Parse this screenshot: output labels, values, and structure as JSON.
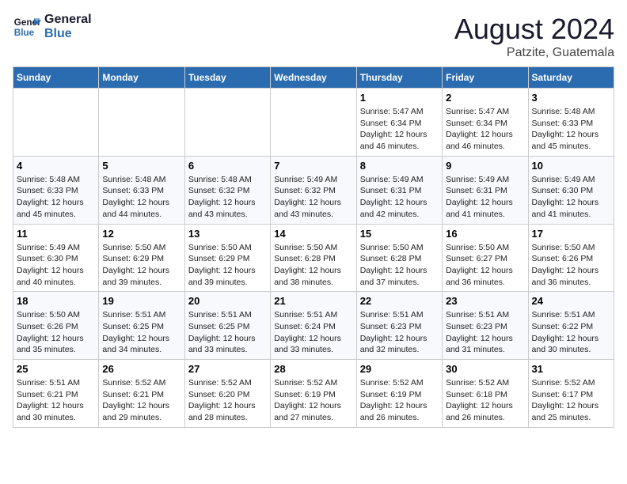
{
  "header": {
    "logo_line1": "General",
    "logo_line2": "Blue",
    "month": "August 2024",
    "location": "Patzite, Guatemala"
  },
  "weekdays": [
    "Sunday",
    "Monday",
    "Tuesday",
    "Wednesday",
    "Thursday",
    "Friday",
    "Saturday"
  ],
  "weeks": [
    [
      {
        "day": "",
        "info": ""
      },
      {
        "day": "",
        "info": ""
      },
      {
        "day": "",
        "info": ""
      },
      {
        "day": "",
        "info": ""
      },
      {
        "day": "1",
        "info": "Sunrise: 5:47 AM\nSunset: 6:34 PM\nDaylight: 12 hours\nand 46 minutes."
      },
      {
        "day": "2",
        "info": "Sunrise: 5:47 AM\nSunset: 6:34 PM\nDaylight: 12 hours\nand 46 minutes."
      },
      {
        "day": "3",
        "info": "Sunrise: 5:48 AM\nSunset: 6:33 PM\nDaylight: 12 hours\nand 45 minutes."
      }
    ],
    [
      {
        "day": "4",
        "info": "Sunrise: 5:48 AM\nSunset: 6:33 PM\nDaylight: 12 hours\nand 45 minutes."
      },
      {
        "day": "5",
        "info": "Sunrise: 5:48 AM\nSunset: 6:33 PM\nDaylight: 12 hours\nand 44 minutes."
      },
      {
        "day": "6",
        "info": "Sunrise: 5:48 AM\nSunset: 6:32 PM\nDaylight: 12 hours\nand 43 minutes."
      },
      {
        "day": "7",
        "info": "Sunrise: 5:49 AM\nSunset: 6:32 PM\nDaylight: 12 hours\nand 43 minutes."
      },
      {
        "day": "8",
        "info": "Sunrise: 5:49 AM\nSunset: 6:31 PM\nDaylight: 12 hours\nand 42 minutes."
      },
      {
        "day": "9",
        "info": "Sunrise: 5:49 AM\nSunset: 6:31 PM\nDaylight: 12 hours\nand 41 minutes."
      },
      {
        "day": "10",
        "info": "Sunrise: 5:49 AM\nSunset: 6:30 PM\nDaylight: 12 hours\nand 41 minutes."
      }
    ],
    [
      {
        "day": "11",
        "info": "Sunrise: 5:49 AM\nSunset: 6:30 PM\nDaylight: 12 hours\nand 40 minutes."
      },
      {
        "day": "12",
        "info": "Sunrise: 5:50 AM\nSunset: 6:29 PM\nDaylight: 12 hours\nand 39 minutes."
      },
      {
        "day": "13",
        "info": "Sunrise: 5:50 AM\nSunset: 6:29 PM\nDaylight: 12 hours\nand 39 minutes."
      },
      {
        "day": "14",
        "info": "Sunrise: 5:50 AM\nSunset: 6:28 PM\nDaylight: 12 hours\nand 38 minutes."
      },
      {
        "day": "15",
        "info": "Sunrise: 5:50 AM\nSunset: 6:28 PM\nDaylight: 12 hours\nand 37 minutes."
      },
      {
        "day": "16",
        "info": "Sunrise: 5:50 AM\nSunset: 6:27 PM\nDaylight: 12 hours\nand 36 minutes."
      },
      {
        "day": "17",
        "info": "Sunrise: 5:50 AM\nSunset: 6:26 PM\nDaylight: 12 hours\nand 36 minutes."
      }
    ],
    [
      {
        "day": "18",
        "info": "Sunrise: 5:50 AM\nSunset: 6:26 PM\nDaylight: 12 hours\nand 35 minutes."
      },
      {
        "day": "19",
        "info": "Sunrise: 5:51 AM\nSunset: 6:25 PM\nDaylight: 12 hours\nand 34 minutes."
      },
      {
        "day": "20",
        "info": "Sunrise: 5:51 AM\nSunset: 6:25 PM\nDaylight: 12 hours\nand 33 minutes."
      },
      {
        "day": "21",
        "info": "Sunrise: 5:51 AM\nSunset: 6:24 PM\nDaylight: 12 hours\nand 33 minutes."
      },
      {
        "day": "22",
        "info": "Sunrise: 5:51 AM\nSunset: 6:23 PM\nDaylight: 12 hours\nand 32 minutes."
      },
      {
        "day": "23",
        "info": "Sunrise: 5:51 AM\nSunset: 6:23 PM\nDaylight: 12 hours\nand 31 minutes."
      },
      {
        "day": "24",
        "info": "Sunrise: 5:51 AM\nSunset: 6:22 PM\nDaylight: 12 hours\nand 30 minutes."
      }
    ],
    [
      {
        "day": "25",
        "info": "Sunrise: 5:51 AM\nSunset: 6:21 PM\nDaylight: 12 hours\nand 30 minutes."
      },
      {
        "day": "26",
        "info": "Sunrise: 5:52 AM\nSunset: 6:21 PM\nDaylight: 12 hours\nand 29 minutes."
      },
      {
        "day": "27",
        "info": "Sunrise: 5:52 AM\nSunset: 6:20 PM\nDaylight: 12 hours\nand 28 minutes."
      },
      {
        "day": "28",
        "info": "Sunrise: 5:52 AM\nSunset: 6:19 PM\nDaylight: 12 hours\nand 27 minutes."
      },
      {
        "day": "29",
        "info": "Sunrise: 5:52 AM\nSunset: 6:19 PM\nDaylight: 12 hours\nand 26 minutes."
      },
      {
        "day": "30",
        "info": "Sunrise: 5:52 AM\nSunset: 6:18 PM\nDaylight: 12 hours\nand 26 minutes."
      },
      {
        "day": "31",
        "info": "Sunrise: 5:52 AM\nSunset: 6:17 PM\nDaylight: 12 hours\nand 25 minutes."
      }
    ]
  ]
}
